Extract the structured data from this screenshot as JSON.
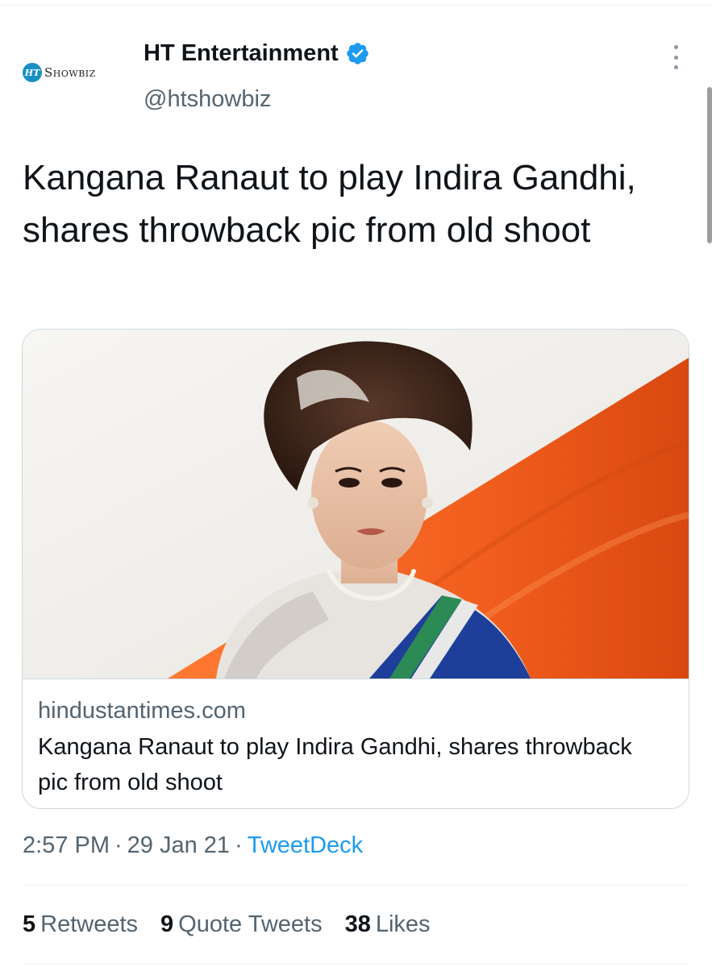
{
  "author": {
    "avatar_logo_text": "HT",
    "avatar_brand_text": "Showbiz",
    "name": "HT Entertainment",
    "handle": "@htshowbiz",
    "verified": true,
    "verified_color": "#1d9bf0"
  },
  "tweet": {
    "text": "Kangana Ranaut to play Indira Gandhi, shares throwback pic from old shoot"
  },
  "card": {
    "domain": "hindustantimes.com",
    "title": "Kangana Ranaut to play Indira Gandhi, shares throwback pic from old shoot"
  },
  "meta": {
    "time": "2:57 PM",
    "separator": "·",
    "date": "29 Jan 21",
    "source": "TweetDeck"
  },
  "stats": {
    "retweets_count": "5",
    "retweets_label": "Retweets",
    "quotes_count": "9",
    "quotes_label": "Quote Tweets",
    "likes_count": "38",
    "likes_label": "Likes"
  },
  "icons": {
    "verified": "verified-badge-icon",
    "more": "more-options-icon"
  },
  "colors": {
    "link": "#1d9bf0",
    "secondary_text": "#536471",
    "primary_text": "#0f1419",
    "border": "#cfd9de",
    "saffron": "#ff6a26"
  }
}
